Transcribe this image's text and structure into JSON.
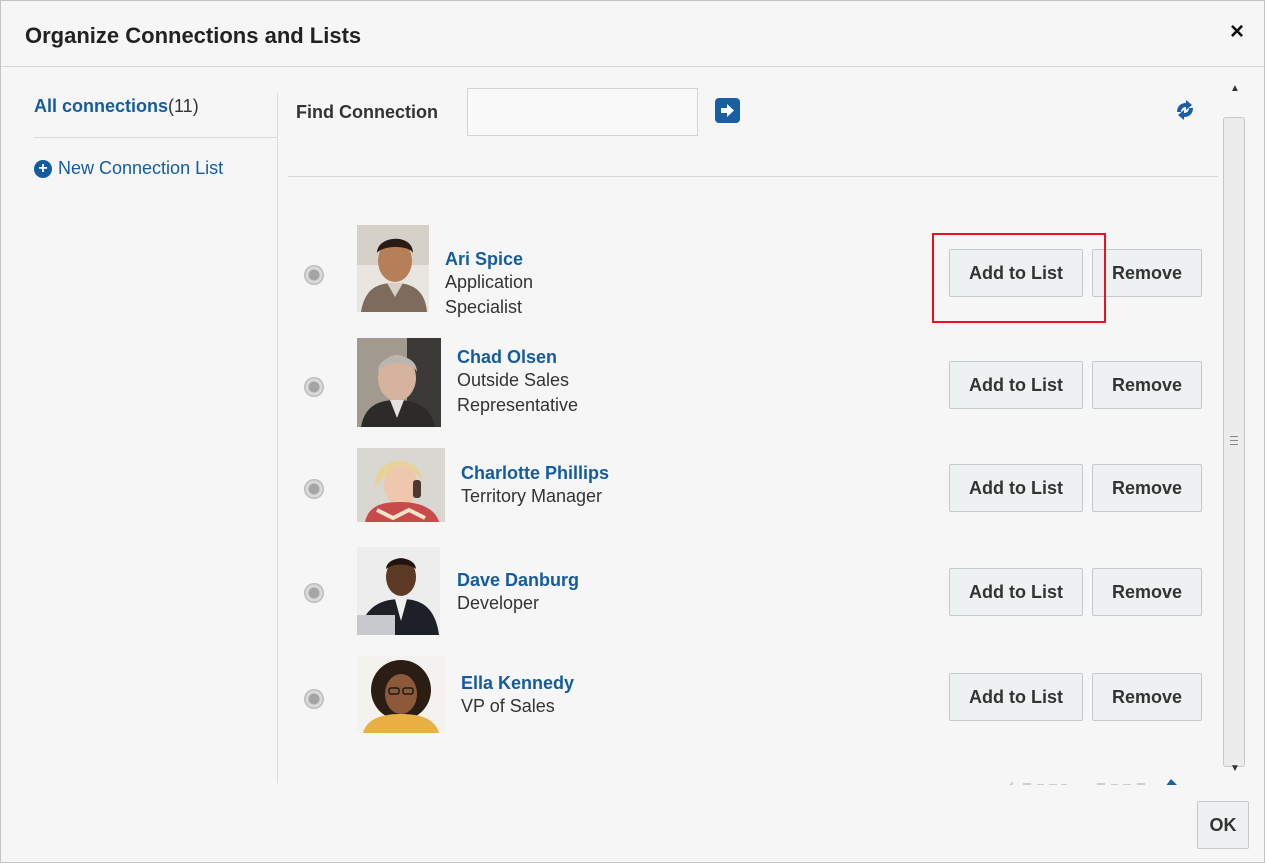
{
  "dialog": {
    "title": "Organize Connections and Lists",
    "close_glyph": "×"
  },
  "sidebar": {
    "all_connections_label": "All connections",
    "all_connections_count": "(11)",
    "new_list_label": "New Connection List"
  },
  "search": {
    "label": "Find Connection",
    "value": "",
    "placeholder": ""
  },
  "connections": [
    {
      "name": "Ari Spice",
      "title": "Application Specialist",
      "add_label": "Add to List",
      "remove_label": "Remove",
      "avatar_icon": "person-photo"
    },
    {
      "name": "Chad Olsen",
      "title": "Outside Sales Representative",
      "add_label": "Add to List",
      "remove_label": "Remove",
      "avatar_icon": "person-photo"
    },
    {
      "name": "Charlotte Phillips",
      "title": "Territory Manager",
      "add_label": "Add to List",
      "remove_label": "Remove",
      "avatar_icon": "person-photo"
    },
    {
      "name": "Dave Danburg",
      "title": "Developer",
      "add_label": "Add to List",
      "remove_label": "Remove",
      "avatar_icon": "person-photo"
    },
    {
      "name": "Ella Kennedy",
      "title": "VP of Sales",
      "add_label": "Add to List",
      "remove_label": "Remove",
      "avatar_icon": "person-photo"
    }
  ],
  "footer": {
    "ok_label": "OK"
  },
  "colors": {
    "link": "#145c9e",
    "highlight": "#e8141d",
    "background": "#f6f6f6"
  },
  "icons": [
    "close-icon",
    "plus-circle-icon",
    "arrow-right-icon",
    "refresh-icon",
    "radio-icon"
  ]
}
